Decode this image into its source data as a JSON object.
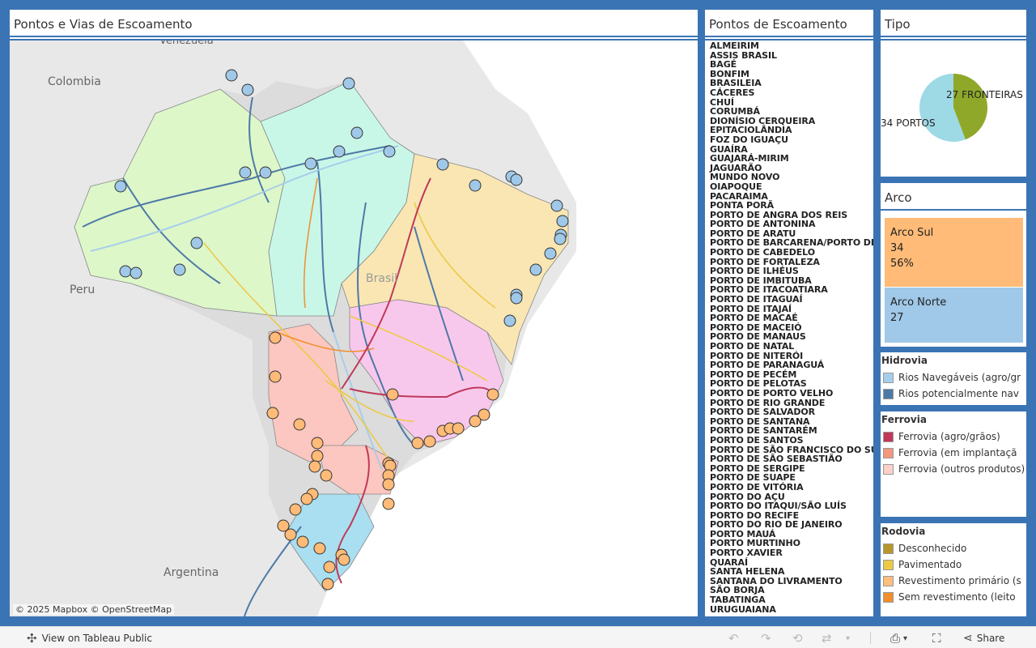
{
  "map_panel": {
    "title": "Pontos e Vias de Escoamento",
    "attribution": "© 2025 Mapbox  © OpenStreetMap",
    "labels": {
      "venezuela": "Venezuela",
      "colombia": "Colombia",
      "peru": "Peru",
      "brasil": "Brasil",
      "argentina": "Argentina"
    },
    "marker_colors": {
      "arco_norte": "#a0c8e8",
      "arco_sul": "#ffbb77"
    }
  },
  "points_panel": {
    "title": "Pontos de Escoamento",
    "items": [
      "ALMEIRIM",
      "ASSIS BRASIL",
      "BAGÉ",
      "BONFIM",
      "BRASILEIA",
      "CÁCERES",
      "CHUÍ",
      "CORUMBÁ",
      "DIONÍSIO CERQUEIRA",
      "EPITACIOLÂNDIA",
      "FOZ DO IGUAÇU",
      "GUAÍRA",
      "GUAJARÁ-MIRIM",
      "JAGUARÃO",
      "MUNDO NOVO",
      "OIAPOQUE",
      "PACARAIMA",
      "PONTA PORÃ",
      "PORTO DE ANGRA DOS REIS",
      "PORTO DE ANTONINA",
      "PORTO DE ARATU",
      "PORTO DE BARCARENA/PORTO DE B",
      "PORTO DE CABEDELO",
      "PORTO DE FORTALEZA",
      "PORTO DE ILHÉUS",
      "PORTO DE IMBITUBA",
      "PORTO DE ITACOATIARA",
      "PORTO DE ITAGUAÍ",
      "PORTO DE ITAJAÍ",
      "PORTO DE MACAÉ",
      "PORTO DE MACEIÓ",
      "PORTO DE MANAUS",
      "PORTO DE NATAL",
      "PORTO DE NITERÓI",
      "PORTO DE PARANAGUÁ",
      "PORTO DE PECÉM",
      "PORTO DE PELOTAS",
      "PORTO DE PORTO VELHO",
      "PORTO DE RIO GRANDE",
      "PORTO DE SALVADOR",
      "PORTO DE SANTANA",
      "PORTO DE SANTARÉM",
      "PORTO DE SANTOS",
      "PORTO DE SÃO FRANCISCO DO SUL",
      "PORTO DE SÃO SEBASTIÃO",
      "PORTO DE SERGIPE",
      "PORTO DE SUAPE",
      "PORTO DE VITÓRIA",
      "PORTO DO AÇU",
      "PORTO DO ITAQUI/SÃO LUÍS",
      "PORTO DO RECIFE",
      "PORTO DO RIO DE JANEIRO",
      "PORTO MAUÁ",
      "PORTO MURTINHO",
      "PORTO XAVIER",
      "QUARAÍ",
      "SANTA HELENA",
      "SANTANA DO LIVRAMENTO",
      "SÃO BORJA",
      "TABATINGA",
      "URUGUAIANA"
    ]
  },
  "tipo_panel": {
    "title": "Tipo",
    "slices": [
      {
        "label": "27 FRONTEIRAS",
        "value": 27,
        "color": "#8fa82a"
      },
      {
        "label": "34 PORTOS",
        "value": 34,
        "color": "#9ed9e6"
      }
    ]
  },
  "arco_panel": {
    "title": "Arco",
    "sul": {
      "name": "Arco Sul",
      "count": "34",
      "pct": "56%",
      "color": "#ffbb77"
    },
    "norte": {
      "name": "Arco Norte",
      "count": "27",
      "color": "#a0c8e8"
    }
  },
  "legends": {
    "hidrovia": {
      "title": "Hidrovia",
      "items": [
        {
          "label": "Rios Navegáveis (agro/gr",
          "color": "#a8cdea"
        },
        {
          "label": "Rios potencialmente nav",
          "color": "#4e79a7"
        }
      ]
    },
    "ferrovia": {
      "title": "Ferrovia",
      "items": [
        {
          "label": "Ferrovia (agro/grãos)",
          "color": "#c0395a"
        },
        {
          "label": "Ferrovia (em implantaçã",
          "color": "#f4977f"
        },
        {
          "label": "Ferrovia (outros produtos)",
          "color": "#fdd0c8"
        }
      ]
    },
    "rodovia": {
      "title": "Rodovia",
      "items": [
        {
          "label": "Desconhecido",
          "color": "#b8962e"
        },
        {
          "label": "Pavimentado",
          "color": "#edc948"
        },
        {
          "label": "Revestimento primário (s",
          "color": "#ffbe7d"
        },
        {
          "label": "Sem revestimento (leito",
          "color": "#f28e2b"
        }
      ]
    }
  },
  "toolbar": {
    "view_label": "View on Tableau Public",
    "share_label": "Share"
  }
}
